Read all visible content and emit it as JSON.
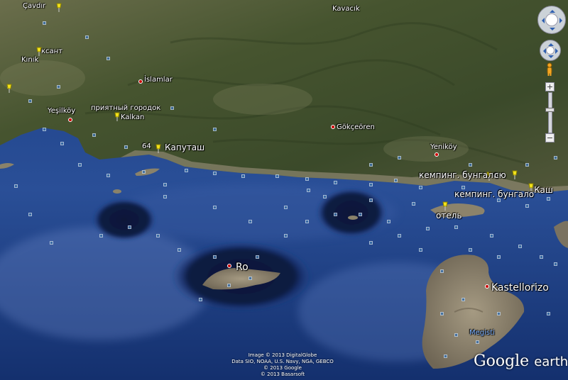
{
  "labels": {
    "kapitas": "Капуташ",
    "num64": "64",
    "yesilkoy": "Yeşilköy",
    "priyatny": "приятный городок",
    "kalkan": "Kalkan",
    "islamlar": "İslamlar",
    "gokceoren": "Gökçeören",
    "yenikoy": "Yeniköy",
    "camping1": "кемпинг. бунгало",
    "su": "сю",
    "kas": "Каш",
    "camping2": "кемпинг. бунгало",
    "hotel": "отель",
    "ro": "Ro",
    "kastellorizo": "Kastellorizo",
    "megisti": "Megisti",
    "ksant": "ксант",
    "kinik": "Kınık",
    "cas": "Çavdır",
    "kavacik": "Kavacık"
  },
  "attribution": {
    "line1": "Image © 2013 DigitalGlobe",
    "line2": "Data SIO, NOAA, U.S. Navy, NGA, GEBCO",
    "line3": "© 2013 Google",
    "line4": "© 2013 Basarsoft"
  },
  "logo": {
    "google": "Google",
    "earth": "earth"
  },
  "controls": {
    "zoom_in": "+",
    "zoom_out": "−"
  },
  "colors": {
    "pin": "#f2e21a",
    "place_dot": "#cc1111",
    "sea_deep": "#0a1a40",
    "land": "#4b5a36"
  }
}
